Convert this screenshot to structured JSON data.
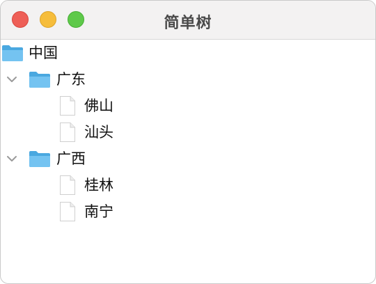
{
  "window": {
    "title": "简单树"
  },
  "tree": {
    "root": {
      "label": "中国",
      "icon": "folder-icon"
    },
    "nodes": [
      {
        "label": "广东",
        "icon": "folder-icon",
        "expanded": true,
        "children": [
          {
            "label": "佛山",
            "icon": "file-icon"
          },
          {
            "label": "汕头",
            "icon": "file-icon"
          }
        ]
      },
      {
        "label": "广西",
        "icon": "folder-icon",
        "expanded": true,
        "children": [
          {
            "label": "桂林",
            "icon": "file-icon"
          },
          {
            "label": "南宁",
            "icon": "file-icon"
          }
        ]
      }
    ]
  }
}
